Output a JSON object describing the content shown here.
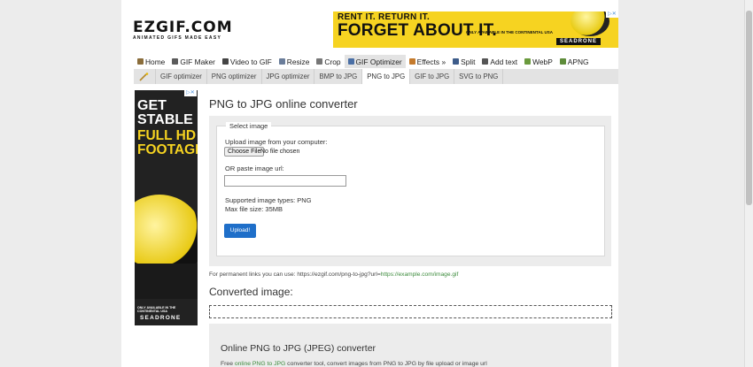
{
  "logo": {
    "name": "EZGIF.COM",
    "tagline": "ANIMATED GIFS MADE EASY"
  },
  "ad_top": {
    "line1": "RENT IT. RETURN IT.",
    "line2": "FORGET ABOUT IT.",
    "fine_print": "ONLY AVAILABLE IN THE CONTINENTAL USA",
    "brand": "SEADRONE",
    "color": "#f6d321"
  },
  "nav": [
    {
      "label": "Home",
      "icon": "home-icon",
      "color": "#8a6d3b"
    },
    {
      "label": "GIF Maker",
      "icon": "gif-maker-icon",
      "color": "#5b5b5b"
    },
    {
      "label": "Video to GIF",
      "icon": "video-icon",
      "color": "#444"
    },
    {
      "label": "Resize",
      "icon": "resize-icon",
      "color": "#6a7d9a"
    },
    {
      "label": "Crop",
      "icon": "crop-icon",
      "color": "#777"
    },
    {
      "label": "GIF Optimizer",
      "icon": "optimizer-icon",
      "color": "#4a6fa5"
    },
    {
      "label": "Effects »",
      "icon": "effects-icon",
      "color": "#c47a2c"
    },
    {
      "label": "Split",
      "icon": "split-icon",
      "color": "#3d5c8a"
    },
    {
      "label": "Add text",
      "icon": "add-text-icon",
      "color": "#555"
    },
    {
      "label": "WebP",
      "icon": "webp-icon",
      "color": "#6a9a3d"
    },
    {
      "label": "APNG",
      "icon": "apng-icon",
      "color": "#5e8c3a"
    }
  ],
  "subnav": [
    "GIF optimizer",
    "PNG optimizer",
    "JPG optimizer",
    "BMP to JPG",
    "PNG to JPG",
    "GIF to JPG",
    "SVG to PNG"
  ],
  "ad_side": {
    "line1": "GET STABLE",
    "line2": "FULL HD FOOTAGE",
    "fine_print": "ONLY AVAILABLE IN THE CONTINENTAL USA",
    "brand": "SEADRONE"
  },
  "main": {
    "title": "PNG to JPG online converter",
    "legend": "Select image",
    "upload_label": "Upload image from your computer:",
    "choose_button": "Choose File",
    "no_file": "No file chosen",
    "url_label": "OR paste image url:",
    "url_value": "",
    "supported": "Supported image types: PNG",
    "max_size": "Max file size: 35MB",
    "upload_button": "Upload!",
    "permalink_prefix": "For permanent links you can use: https://ezgif.com/png-to-jpg?url=",
    "permalink_link": "https://example.com/image.gif",
    "converted_title": "Converted image:",
    "info_title": "Online PNG to JPG (JPEG) converter",
    "info_text_prefix": "Free ",
    "info_text_link": "online PNG to JPG",
    "info_text_rest": " converter tool, convert images from PNG to JPG by file upload or image url"
  }
}
